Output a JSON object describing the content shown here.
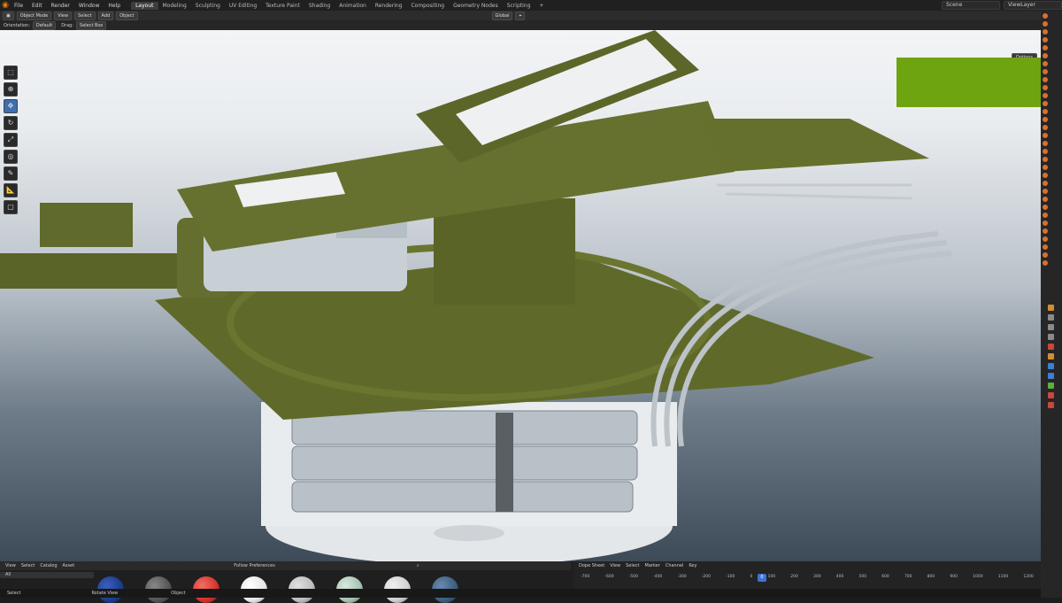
{
  "topbar": {
    "menus": [
      "File",
      "Edit",
      "Render",
      "Window",
      "Help"
    ],
    "workspaces": [
      "Layout",
      "Modeling",
      "Sculpting",
      "UV Editing",
      "Texture Paint",
      "Shading",
      "Animation",
      "Rendering",
      "Compositing",
      "Geometry Nodes",
      "Scripting"
    ],
    "active_workspace": "Layout",
    "scene_label": "Scene",
    "viewlayer_label": "ViewLayer"
  },
  "header": {
    "mode": "Object Mode",
    "menus": [
      "View",
      "Select",
      "Add",
      "Object"
    ],
    "transform": "Global"
  },
  "tool_settings": {
    "orientation_label": "Orientation:",
    "orientation_value": "Default",
    "drag_label": "Drag:",
    "drag_value": "Select Box"
  },
  "viewport": {
    "options_label": "Options",
    "toolbar_tools": [
      "select-box",
      "cursor",
      "move",
      "rotate",
      "scale",
      "transform",
      "annotate",
      "measure",
      "add-cube"
    ],
    "active_tool": "move",
    "gizmo_colors": {
      "x": "#e5453b",
      "y": "#7ab62f",
      "z": "#3a7fd6"
    }
  },
  "asset_browser": {
    "menus": [
      "View",
      "Select",
      "Catalog",
      "Asset"
    ],
    "follow_prefs": "Follow Preferences",
    "filter": "All",
    "materials": [
      "#1b3d8c",
      "#555555",
      "#d4322c",
      "#e6e6e6",
      "#bdbdbd",
      "#a7c2b1",
      "#cfcfcf",
      "#3e5e7e",
      "#bfbfbf"
    ]
  },
  "timeline": {
    "editor": "Dope Sheet",
    "menus": [
      "View",
      "Select",
      "Marker",
      "Channel",
      "Key"
    ],
    "ticks": [
      "-700",
      "-600",
      "-500",
      "-400",
      "-300",
      "-200",
      "-100",
      "0",
      "100",
      "200",
      "300",
      "400",
      "500",
      "600",
      "700",
      "800",
      "900",
      "1000",
      "1100",
      "1200"
    ],
    "current_frame": "0"
  },
  "status": {
    "left": "Select",
    "middle": "Rotate View",
    "right": "Object"
  }
}
